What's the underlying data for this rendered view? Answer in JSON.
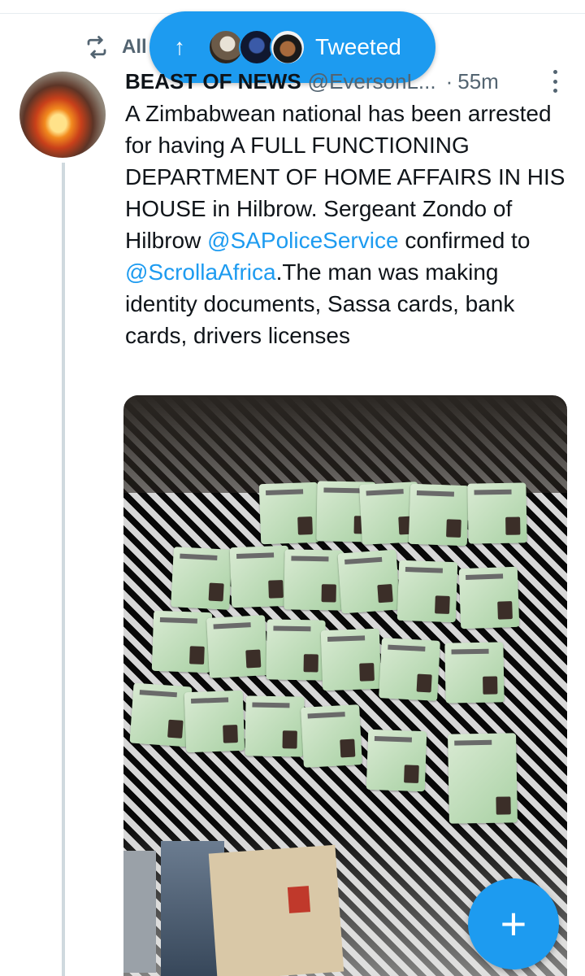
{
  "retweet": {
    "label": "All"
  },
  "pill": {
    "label": "Tweeted"
  },
  "tweet": {
    "name": "BEAST OF NEWS",
    "handle": "@EversonL...",
    "time": "55m",
    "text_1": "A Zimbabwean national has been arrested for having A FULL FUNCTIONING DEPARTMENT OF HOME AFFAIRS IN HIS HOUSE in Hilbrow. Sergeant Zondo of Hilbrow ",
    "mention_1": "@SAPoliceService",
    "text_2": " confirmed to ",
    "mention_2": "@ScrollaAfrica",
    "text_3": ".The man was making identity documents, Sassa cards, bank cards, drivers licenses"
  },
  "colors": {
    "accent": "#1d9bf0",
    "muted": "#536471",
    "thread": "#cfd9de"
  },
  "icons": {
    "retweet": "retweet-icon",
    "arrow": "arrow-up-icon",
    "more": "more-vertical-icon",
    "compose": "plus-icon"
  }
}
